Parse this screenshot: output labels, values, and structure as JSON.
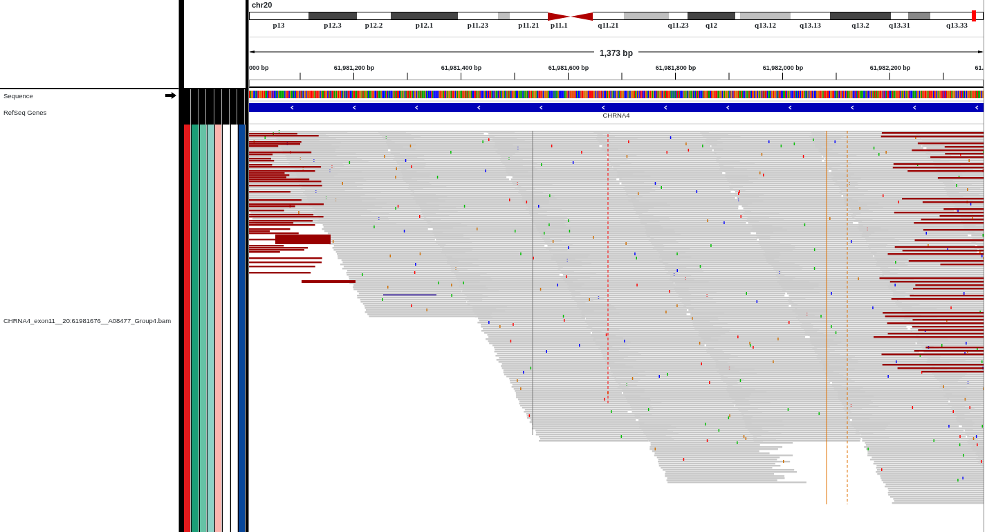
{
  "chromosome": "chr20",
  "ideogram": {
    "bands": [
      {
        "label": "p13",
        "kind": "gneg"
      },
      {
        "label": "p12.3",
        "kind": "gpos75"
      },
      {
        "label": "p12.2",
        "kind": "gneg"
      },
      {
        "label": "p12.1",
        "kind": "gpos75"
      },
      {
        "label": "p11.23",
        "kind": "gneg"
      },
      {
        "kind": "gpos25"
      },
      {
        "label": "p11.21",
        "kind": "gneg"
      },
      {
        "label": "p11.1",
        "kind": "acenp"
      },
      {
        "kind": "acenq"
      },
      {
        "label": "q11.21",
        "kind": "gneg"
      },
      {
        "kind": "gpos25"
      },
      {
        "label": "q11.23",
        "kind": "gneg"
      },
      {
        "label": "q12",
        "kind": "gpos75"
      },
      {
        "kind": "gneg"
      },
      {
        "label": "q13.12",
        "kind": "gpos25"
      },
      {
        "label": "q13.13",
        "kind": "gneg"
      },
      {
        "label": "q13.2",
        "kind": "gpos75"
      },
      {
        "label": "q13.31",
        "kind": "gneg"
      },
      {
        "kind": "gpos50"
      },
      {
        "label": "q13.33",
        "kind": "gneg"
      }
    ]
  },
  "ruler": {
    "span": "1,373 bp",
    "tick_labels": [
      "000 bp",
      "61,981,200 bp",
      "61,981,400 bp",
      "61,981,600 bp",
      "61,981,800 bp",
      "61,982,000 bp",
      "61,982,200 bp",
      "61."
    ]
  },
  "tracks": [
    {
      "kind": "sequence",
      "name": "Sequence"
    },
    {
      "kind": "genes",
      "name": "RefSeq Genes",
      "gene": "CHRNA4"
    },
    {
      "kind": "alignments",
      "name": "CHRNA4_exon11__20:61981676__A08477_Group4.bam"
    }
  ],
  "attributes": [
    {
      "color": "#e31a1c"
    },
    {
      "color": "#1b9e77"
    },
    {
      "color": "#66c2a5"
    },
    {
      "color": "#8dd3c7"
    },
    {
      "color": "#fbb4ae"
    },
    {
      "color": "#ffffff"
    },
    {
      "color": "#ffffff"
    },
    {
      "color": "#08479a"
    }
  ]
}
